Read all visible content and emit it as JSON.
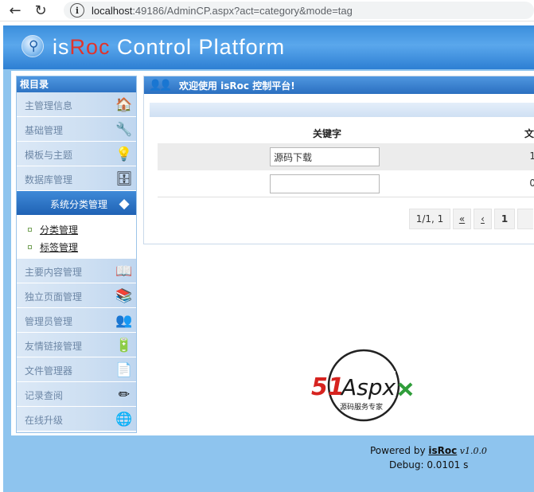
{
  "browser": {
    "back_icon": "back-arrow-icon",
    "reload_icon": "reload-icon",
    "url_host": "localhost",
    "url_rest": ":49186/AdminCP.aspx?act=category&mode=tag"
  },
  "header": {
    "brand_part1": "is",
    "brand_part2": "Roc",
    "brand_part3": " Control Platform",
    "brand_color_red": "#e0342c"
  },
  "sidebar": {
    "title": "根目录",
    "items": [
      {
        "label": "主管理信息",
        "icon": "house-icon"
      },
      {
        "label": "基础管理",
        "icon": "tools-icon"
      },
      {
        "label": "模板与主题",
        "icon": "lightbulb-icon"
      },
      {
        "label": "数据库管理",
        "icon": "database-icon"
      },
      {
        "label": "系统分类管理",
        "icon": "tag-icon"
      },
      {
        "label": "主要内容管理",
        "icon": "book-icon"
      },
      {
        "label": "独立页面管理",
        "icon": "books-icon"
      },
      {
        "label": "管理员管理",
        "icon": "users-icon"
      },
      {
        "label": "友情链接管理",
        "icon": "battery-icon"
      },
      {
        "label": "文件管理器",
        "icon": "file-icon"
      },
      {
        "label": "记录查阅",
        "icon": "pencil-icon"
      },
      {
        "label": "在线升级",
        "icon": "globe-icon"
      }
    ],
    "submenu": [
      {
        "label": "分类管理"
      },
      {
        "label": "标签管理"
      }
    ]
  },
  "content": {
    "welcome": "欢迎使用 isRoc 控制平台!",
    "columns": [
      "关键字",
      "文"
    ],
    "rows": [
      {
        "keyword": "源码下载",
        "count": "1"
      },
      {
        "keyword": "",
        "count": "0"
      }
    ],
    "pager": [
      "1/1, 1",
      "«",
      "‹",
      "1"
    ]
  },
  "logo": {
    "text_51": "51",
    "text_aspx": "Aspx",
    "tagline": "源码服务专家"
  },
  "footer": {
    "powered_prefix": "Powered by ",
    "powered_brand": "isRoc",
    "version": " v1.0.0",
    "debug": "Debug: 0.0101 s"
  },
  "colors": {
    "page_bg": "#8ec4ee",
    "header_blue": "#3b8edc",
    "menu_active": "#2e74c4"
  }
}
